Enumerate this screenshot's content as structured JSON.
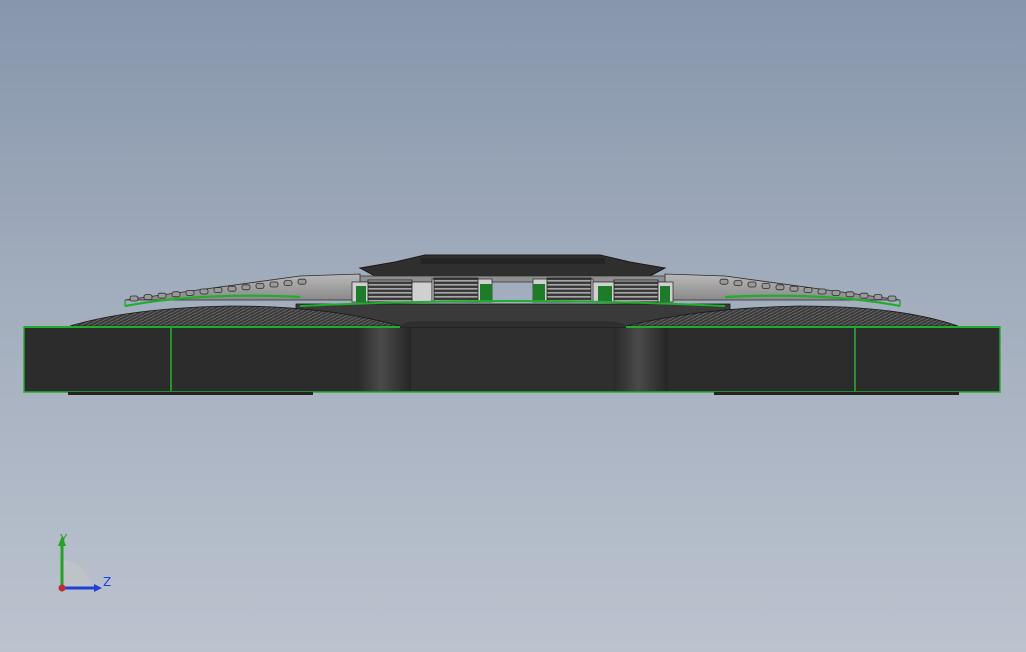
{
  "app": {
    "type": "CAD model viewport"
  },
  "model": {
    "view": "side",
    "colors": {
      "body": "#2e2e2e",
      "body_dark": "#1f1f1f",
      "edge": "#1fae2c",
      "plate": "#8c8c8c",
      "plate_light": "#b4b4b4",
      "fan_dark": "#3a3a3a",
      "coil": "#9a9a9a"
    }
  },
  "triad": {
    "y_label": "Y",
    "z_label": "Z",
    "y_color": "#22a322",
    "z_color": "#1f3fd6",
    "x_color": "#c62a2a"
  },
  "background": {
    "top": "#8796ac",
    "bottom": "#bcc3cf"
  }
}
